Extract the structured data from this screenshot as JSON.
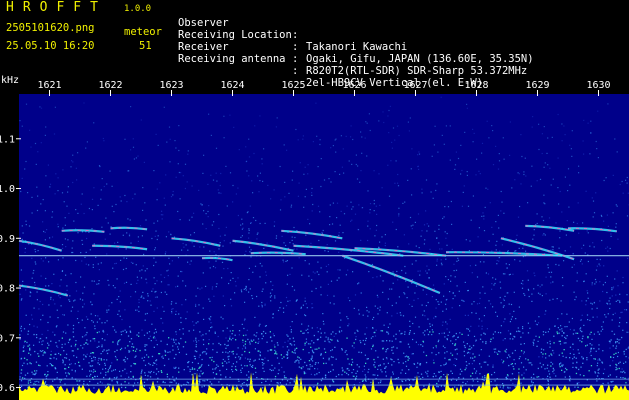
{
  "header": {
    "app_name": "HROFFT",
    "version": "1.0.0",
    "file_name": "2505101620.png",
    "meteor_label": "meteor",
    "datetime": "25.05.10 16:20",
    "meteor_count": "51",
    "info": [
      {
        "label": "Observer",
        "value": "Takanori Kawachi"
      },
      {
        "label": "Receiving Location",
        "value": "Ogaki, Gifu, JAPAN (136.60E, 35.35N)"
      },
      {
        "label": "Receiver",
        "value": "R820T2(RTL-SDR) SDR-Sharp 53.372MHz"
      },
      {
        "label": "Receiving antenna",
        "value": "2el-HB9CV Vertical (el. E-W)"
      }
    ],
    "separator": ":"
  },
  "chart_data": {
    "type": "heatmap",
    "ylabel": "kHz",
    "x_ticks": [
      "1621",
      "1622",
      "1623",
      "1624",
      "1625",
      "1626",
      "1627",
      "1628",
      "1629",
      "1630"
    ],
    "y_ticks": [
      "1.1",
      "1.0",
      "0.9",
      "0.8",
      "0.7",
      "0.6"
    ],
    "y_tick_values": [
      1.1,
      1.0,
      0.9,
      0.8,
      0.7,
      0.6
    ],
    "ylim": [
      0.575,
      1.19
    ],
    "xlim": [
      1620.5,
      1630.5
    ],
    "colors": {
      "background": "#00008a",
      "noise": "#3fa0ff",
      "echo": "#ff60c0",
      "baseline": "#ffff00"
    },
    "carrier_lines_khz": [
      0.865,
      0.617,
      0.605
    ],
    "echoes": [
      {
        "x": [
          1620.5,
          1621.2
        ],
        "y": [
          0.895,
          0.875
        ]
      },
      {
        "x": [
          1620.5,
          1621.3
        ],
        "y": [
          0.805,
          0.785
        ]
      },
      {
        "x": [
          1621.2,
          1621.9
        ],
        "y": [
          0.915,
          0.913
        ]
      },
      {
        "x": [
          1622.0,
          1622.6
        ],
        "y": [
          0.92,
          0.918
        ]
      },
      {
        "x": [
          1621.7,
          1622.6
        ],
        "y": [
          0.885,
          0.878
        ]
      },
      {
        "x": [
          1623.0,
          1623.8
        ],
        "y": [
          0.9,
          0.885
        ]
      },
      {
        "x": [
          1623.5,
          1624.0
        ],
        "y": [
          0.86,
          0.856
        ]
      },
      {
        "x": [
          1624.0,
          1625.0
        ],
        "y": [
          0.895,
          0.875
        ]
      },
      {
        "x": [
          1624.8,
          1625.8
        ],
        "y": [
          0.915,
          0.9
        ]
      },
      {
        "x": [
          1624.3,
          1625.2
        ],
        "y": [
          0.87,
          0.868
        ]
      },
      {
        "x": [
          1625.0,
          1626.8
        ],
        "y": [
          0.885,
          0.865
        ]
      },
      {
        "x": [
          1625.8,
          1627.4
        ],
        "y": [
          0.865,
          0.79
        ]
      },
      {
        "x": [
          1626.0,
          1627.5
        ],
        "y": [
          0.88,
          0.865
        ]
      },
      {
        "x": [
          1627.5,
          1629.4
        ],
        "y": [
          0.872,
          0.865
        ]
      },
      {
        "x": [
          1628.8,
          1629.6
        ],
        "y": [
          0.925,
          0.915
        ]
      },
      {
        "x": [
          1628.4,
          1629.6
        ],
        "y": [
          0.9,
          0.858
        ]
      },
      {
        "x": [
          1629.5,
          1630.3
        ],
        "y": [
          0.92,
          0.914
        ]
      }
    ]
  }
}
